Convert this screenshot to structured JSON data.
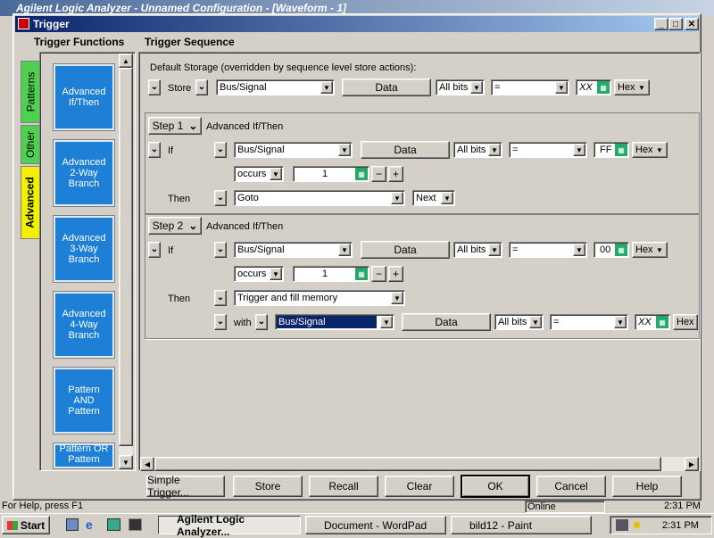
{
  "parent_window": {
    "title": "Agilent Logic Analyzer - Unnamed Configuration - [Waveform - 1]"
  },
  "dialog": {
    "title": "Trigger",
    "trigger_functions_label": "Trigger Functions",
    "trigger_sequence_label": "Trigger Sequence",
    "tabs": [
      "Patterns",
      "Other",
      "Advanced"
    ],
    "functions": [
      "Advanced If/Then",
      "Advanced 2-Way Branch",
      "Advanced 3-Way Branch",
      "Advanced 4-Way Branch",
      "Pattern AND Pattern",
      "Pattern OR Pattern"
    ],
    "default_storage": {
      "label": "Default Storage (overridden by sequence level store actions):",
      "action": "Store",
      "signal": "Bus/Signal",
      "data_button": "Data",
      "bits": "All bits",
      "operator": "=",
      "value": "XX",
      "base": "Hex"
    },
    "steps": [
      {
        "step_label": "Step 1",
        "function": "Advanced If/Then",
        "if_label": "If",
        "signal": "Bus/Signal",
        "data_button": "Data",
        "bits": "All bits",
        "operator": "=",
        "value": "FF",
        "base": "Hex",
        "occurs": "occurs",
        "count": "1",
        "then_label": "Then",
        "action": "Goto",
        "target": "Next"
      },
      {
        "step_label": "Step 2",
        "function": "Advanced If/Then",
        "if_label": "If",
        "signal": "Bus/Signal",
        "data_button": "Data",
        "bits": "All bits",
        "operator": "=",
        "value": "00",
        "base": "Hex",
        "occurs": "occurs",
        "count": "1",
        "then_label": "Then",
        "action": "Trigger and fill memory",
        "with_label": "with",
        "with_signal": "Bus/Signal",
        "with_data_button": "Data",
        "with_bits": "All bits",
        "with_operator": "=",
        "with_value": "XX",
        "with_base": "Hex"
      }
    ],
    "buttons": {
      "simple_trigger": "Simple Trigger...",
      "store": "Store",
      "recall": "Recall",
      "clear": "Clear",
      "ok": "OK",
      "cancel": "Cancel",
      "help": "Help"
    }
  },
  "status_bar": {
    "help_text": "For Help, press F1",
    "online": "Online",
    "time": "2:31 PM"
  },
  "taskbar": {
    "start_label": "Start",
    "tasks": [
      "Agilent Logic Analyzer...",
      "Document - WordPad",
      "bild12 - Paint"
    ],
    "clock": "2:31 PM"
  },
  "colors": {
    "function_button": "#1e7fd6",
    "advanced_tab": "#f0f000",
    "patterns_tab": "#50d050",
    "other_tab": "#50d050",
    "title_start": "#0a246a",
    "title_end": "#a6caf0"
  }
}
